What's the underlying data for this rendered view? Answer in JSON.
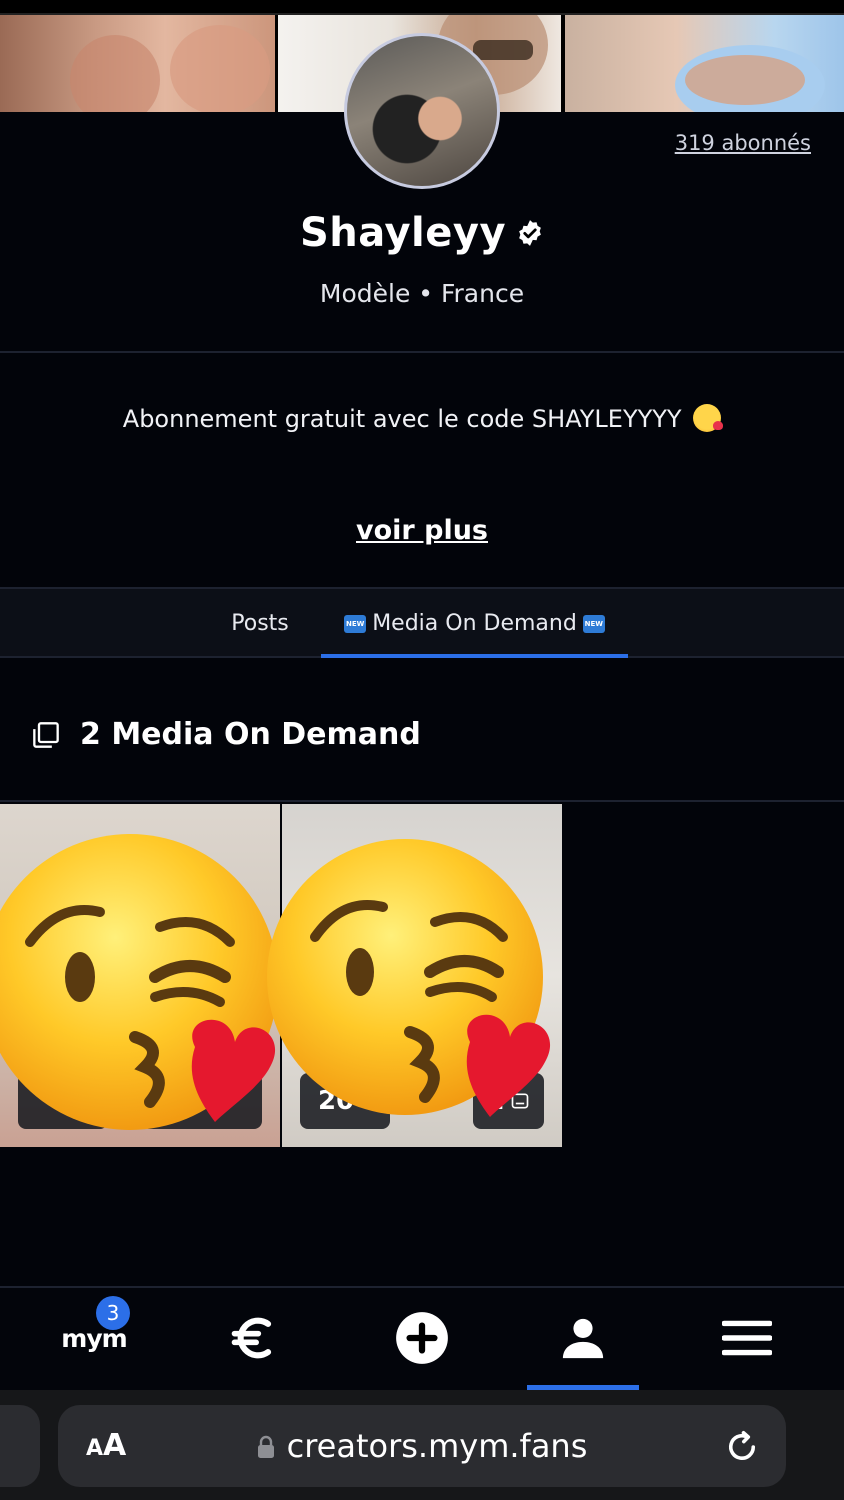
{
  "profile": {
    "followers": "319 abonnés",
    "name": "Shayleyy",
    "subtitle": "Modèle • France",
    "bio": "Abonnement gratuit avec le code SHAYLEYYYY",
    "see_more": "voir plus"
  },
  "tabs": [
    {
      "label": "Posts",
      "active": false
    },
    {
      "label": "Media On Demand",
      "badge": "NEW",
      "active": true
    }
  ],
  "section": {
    "title": "2 Media On Demand"
  },
  "media": [
    {
      "date": "",
      "count": ""
    },
    {
      "date": "20",
      "count": "1"
    }
  ],
  "bottom_nav": {
    "logo": "mym",
    "notification_count": "3",
    "items": [
      "mym-logo",
      "euro-icon",
      "add-icon",
      "profile-icon",
      "menu-icon"
    ],
    "active_index": 3
  },
  "browser": {
    "aa_small": "A",
    "aa_large": "A",
    "url": "creators.mym.fans"
  },
  "colors": {
    "accent": "#2c6fe8",
    "background": "#02040a"
  }
}
